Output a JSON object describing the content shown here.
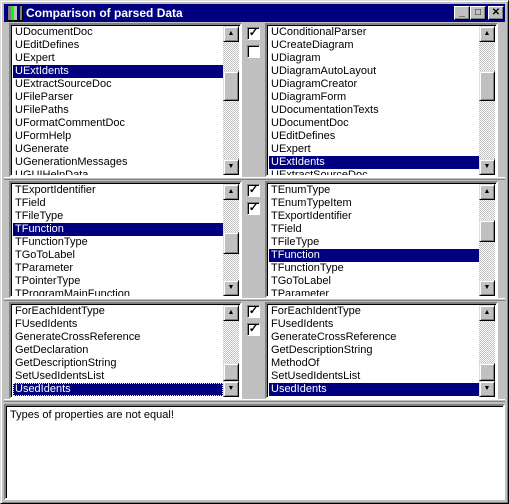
{
  "window": {
    "title": "Comparison of parsed Data",
    "minimize": "_",
    "maximize": "□",
    "close": "✕"
  },
  "panels": [
    {
      "left": {
        "items": [
          "UDocumentDoc",
          "UEditDefines",
          "UExpert",
          "UExtIdents",
          "UExtractSourceDoc",
          "UFileParser",
          "UFilePaths",
          "UFormatCommentDoc",
          "UFormHelp",
          "UGenerate",
          "UGenerationMessages",
          "UGUIHelpData"
        ],
        "selected": 3,
        "scroll_fraction": 0.33
      },
      "right": {
        "items": [
          "UConditionalParser",
          "UCreateDiagram",
          "UDiagram",
          "UDiagramAutoLayout",
          "UDiagramCreator",
          "UDiagramForm",
          "UDocumentationTexts",
          "UDocumentDoc",
          "UEditDefines",
          "UExpert",
          "UExtIdents",
          "UExtractSourceDoc"
        ],
        "selected": 10,
        "scroll_fraction": 0.33
      },
      "checks": [
        true,
        false
      ]
    },
    {
      "left": {
        "items": [
          "TExportIdentifier",
          "TField",
          "TFileType",
          "TFunction",
          "TFunctionType",
          "TGoToLabel",
          "TParameter",
          "TPointerType",
          "TProgramMainFunction"
        ],
        "selected": 3,
        "scroll_fraction": 0.55
      },
      "right": {
        "items": [
          "TEnumType",
          "TEnumTypeItem",
          "TExportIdentifier",
          "TField",
          "TFileType",
          "TFunction",
          "TFunctionType",
          "TGoToLabel",
          "TParameter"
        ],
        "selected": 5,
        "scroll_fraction": 0.35
      },
      "checks": [
        true,
        true
      ]
    },
    {
      "left": {
        "items": [
          "ForEachIdentType",
          "FUsedIdents",
          "GenerateCrossReference",
          "GetDeclaration",
          "GetDescriptionString",
          "SetUsedIdentsList",
          "UsedIdents"
        ],
        "selected": 6,
        "focused": true,
        "scroll_fraction": 1.0
      },
      "right": {
        "items": [
          "ForEachIdentType",
          "FUsedIdents",
          "GenerateCrossReference",
          "GetDescriptionString",
          "MethodOf",
          "SetUsedIdentsList",
          "UsedIdents"
        ],
        "selected": 6,
        "scroll_fraction": 1.0
      },
      "checks": [
        true,
        true
      ]
    }
  ],
  "message": "Types of properties are not equal!",
  "colors": {
    "selection": "#000080",
    "face": "#c0c0c0"
  }
}
